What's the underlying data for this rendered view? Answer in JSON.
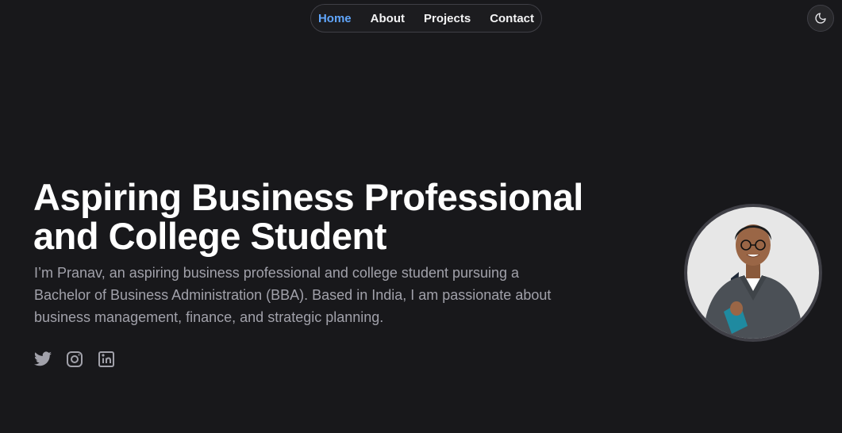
{
  "nav": {
    "items": [
      {
        "label": "Home",
        "active": true
      },
      {
        "label": "About",
        "active": false
      },
      {
        "label": "Projects",
        "active": false
      },
      {
        "label": "Contact",
        "active": false
      }
    ]
  },
  "theme_toggle": {
    "icon": "moon-icon"
  },
  "hero": {
    "title_line1": "Aspiring Business Professional",
    "title_line2": "and College Student",
    "desc_line1": "I’m Pranav, an aspiring business professional and college student pursuing a",
    "desc_line2": "Bachelor of Business Administration (BBA). Based in India, I am passionate about",
    "desc_line3": "business management, finance, and strategic planning."
  },
  "socials": [
    {
      "icon": "twitter-icon"
    },
    {
      "icon": "instagram-icon"
    },
    {
      "icon": "linkedin-icon"
    }
  ],
  "colors": {
    "background": "#18181b",
    "accent": "#60a5fa",
    "muted_text": "#a1a1aa",
    "icon": "#a1a1aa"
  }
}
